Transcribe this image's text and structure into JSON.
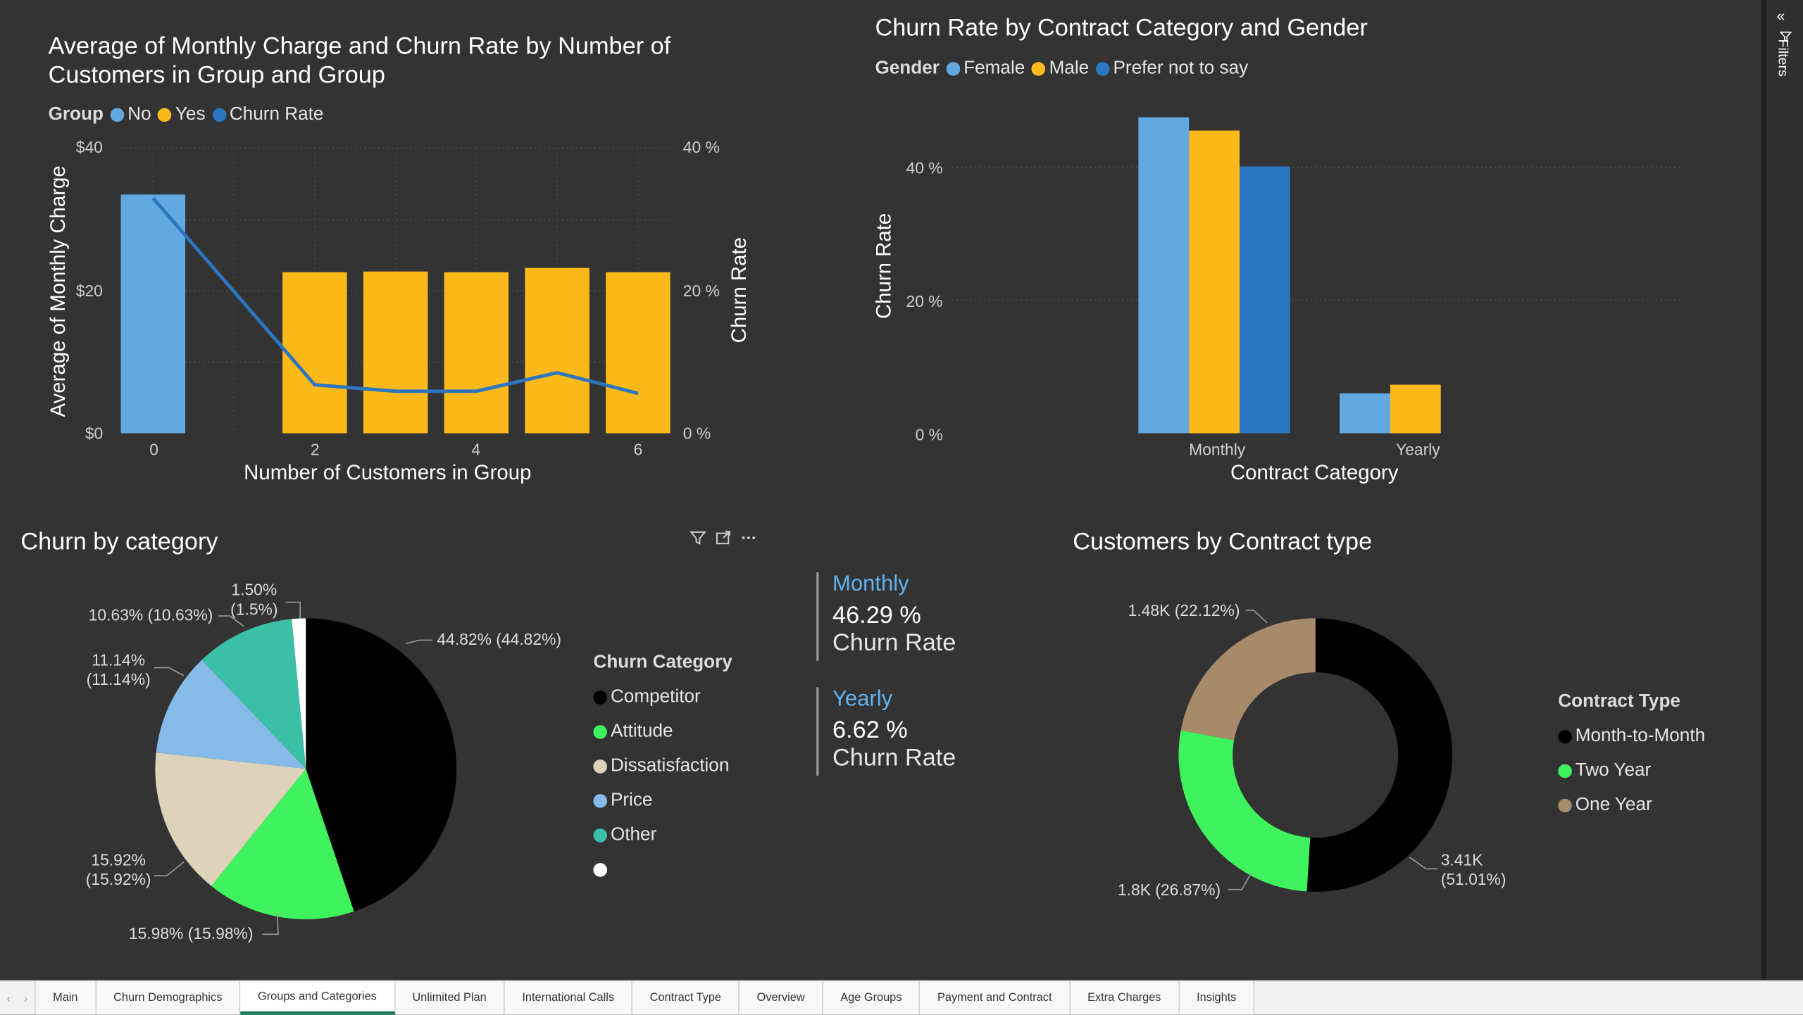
{
  "colors": {
    "no": "#62a9e2",
    "yes": "#fbb91a",
    "churn_line": "#2c75bf",
    "female": "#62a9e2",
    "male": "#fbb91a",
    "prefer_not": "#2c75bf",
    "competitor": "#000000",
    "attitude": "#3ff35e",
    "dissatisfaction": "#ddd3ba",
    "price": "#86bbe9",
    "other": "#3bbfa6",
    "blank": "#ffffff",
    "month_to_month": "#000000",
    "two_year": "#3ff35e",
    "one_year": "#a78a6a",
    "card_accent": "#62b3f0"
  },
  "chart1": {
    "title": "Average of Monthly Charge and Churn Rate by Number of Customers in Group and Group",
    "legend_title": "Group",
    "legend": [
      "No",
      "Yes",
      "Churn Rate"
    ],
    "y_left_ticks": [
      "$40",
      "$20",
      "$0"
    ],
    "y_right_ticks": [
      "40 %",
      "20 %",
      "0 %"
    ],
    "x_ticks": [
      "0",
      "2",
      "4",
      "6"
    ],
    "x_title": "Number of Customers in Group",
    "y_left_title": "Average of Monthly Charge",
    "y_right_title": "Churn Rate"
  },
  "chart2": {
    "title": "Churn Rate by Contract Category and Gender",
    "legend_title": "Gender",
    "legend": [
      "Female",
      "Male",
      "Prefer not to say"
    ],
    "y_ticks": [
      "40 %",
      "20 %",
      "0 %"
    ],
    "x_ticks": [
      "Monthly",
      "Yearly"
    ],
    "x_title": "Contract Category",
    "y_title": "Churn Rate"
  },
  "chart3": {
    "title": "Churn by category",
    "legend_title": "Churn Category",
    "legend": [
      "Competitor",
      "Attitude",
      "Dissatisfaction",
      "Price",
      "Other",
      ""
    ],
    "labels": {
      "competitor": "44.82% (44.82%)",
      "attitude": "15.98% (15.98%)",
      "dissatisfaction_1": "15.92%",
      "dissatisfaction_2": "(15.92%)",
      "price_1": "11.14%",
      "price_2": "(11.14%)",
      "other": "10.63% (10.63%)",
      "blank_1": "1.50%",
      "blank_2": "(1.5%)"
    }
  },
  "cards": [
    {
      "head": "Monthly",
      "value": "46.29 %",
      "sub": "Churn Rate"
    },
    {
      "head": "Yearly",
      "value": "6.62 %",
      "sub": "Churn Rate"
    }
  ],
  "chart4": {
    "title": "Customers by Contract type",
    "legend_title": "Contract Type",
    "legend": [
      "Month-to-Month",
      "Two Year",
      "One Year"
    ],
    "labels": {
      "one_year": "1.48K (22.12%)",
      "two_year": "1.8K (26.87%)",
      "mtm_1": "3.41K",
      "mtm_2": "(51.01%)"
    }
  },
  "chart_data": [
    {
      "type": "bar",
      "title": "Average of Monthly Charge and Churn Rate by Number of Customers in Group and Group",
      "xlabel": "Number of Customers in Group",
      "ylabel": "Average of Monthly Charge",
      "y2label": "Churn Rate",
      "x": [
        0,
        2,
        3,
        4,
        5,
        6
      ],
      "series": [
        {
          "name": "No",
          "x": [
            0
          ],
          "values": [
            33.5
          ]
        },
        {
          "name": "Yes",
          "x": [
            2,
            3,
            4,
            5,
            6
          ],
          "values": [
            22.6,
            22.7,
            22.6,
            23.2,
            22.6
          ]
        },
        {
          "name": "Churn Rate",
          "type": "line",
          "axis": "right",
          "x": [
            0,
            2,
            3,
            4,
            5,
            6
          ],
          "values": [
            33.0,
            6.8,
            5.9,
            5.9,
            8.5,
            5.6
          ]
        }
      ],
      "ylim": [
        0,
        40
      ],
      "y2lim": [
        0,
        40
      ],
      "legend_position": "top-left",
      "grid": true
    },
    {
      "type": "bar",
      "title": "Churn Rate by Contract Category and Gender",
      "categories": [
        "Monthly",
        "Yearly"
      ],
      "xlabel": "Contract Category",
      "ylabel": "Churn Rate",
      "series": [
        {
          "name": "Female",
          "values": [
            47.5,
            6.0
          ]
        },
        {
          "name": "Male",
          "values": [
            45.5,
            7.3
          ]
        },
        {
          "name": "Prefer not to say",
          "values": [
            40.1,
            null
          ]
        }
      ],
      "ylim": [
        0,
        45
      ],
      "legend_position": "top-left",
      "grid": true
    },
    {
      "type": "pie",
      "title": "Churn by category",
      "categories": [
        "Competitor",
        "Attitude",
        "Dissatisfaction",
        "Price",
        "Other",
        ""
      ],
      "values": [
        44.82,
        15.98,
        15.92,
        11.14,
        10.63,
        1.5
      ],
      "legend_position": "right"
    },
    {
      "type": "pie",
      "title": "Customers by Contract type",
      "categories": [
        "Month-to-Month",
        "Two Year",
        "One Year"
      ],
      "values": [
        51.01,
        26.87,
        22.12
      ],
      "counts": [
        "3.41K",
        "1.8K",
        "1.48K"
      ],
      "donut": true,
      "legend_position": "right"
    }
  ],
  "visual_header_icons": [
    "filter-icon",
    "focus-mode-icon",
    "more-options-icon"
  ],
  "tabs": [
    "Main",
    "Churn Demographics",
    "Groups and Categories",
    "Unlimited Plan",
    "International Calls",
    "Contract Type",
    "Overview",
    "Age Groups",
    "Payment and Contract",
    "Extra Charges",
    "Insights"
  ],
  "active_tab": "Groups and Categories",
  "filters_pane": {
    "label": "Filters"
  }
}
